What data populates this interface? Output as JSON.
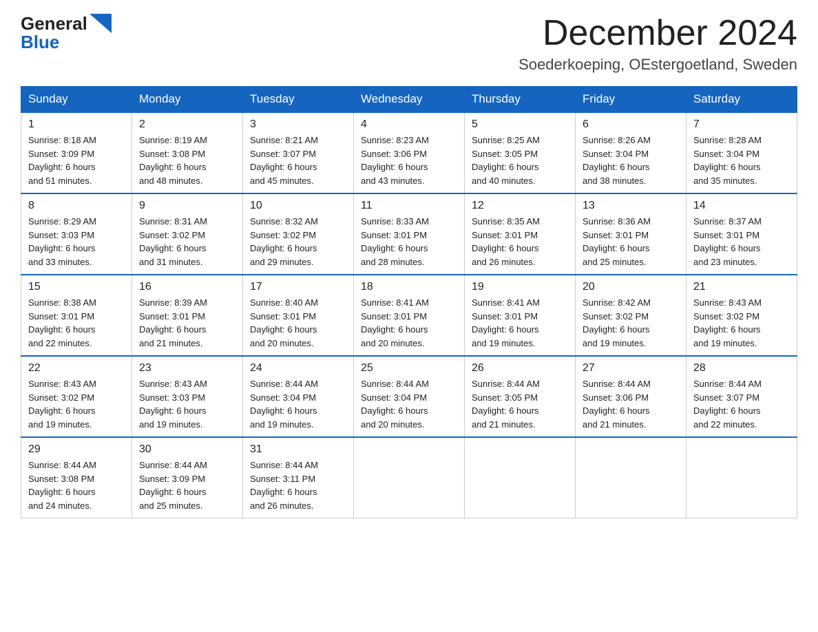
{
  "header": {
    "logo_general": "General",
    "logo_blue": "Blue",
    "month_title": "December 2024",
    "location": "Soederkoeping, OEstergoetland, Sweden"
  },
  "weekdays": [
    "Sunday",
    "Monday",
    "Tuesday",
    "Wednesday",
    "Thursday",
    "Friday",
    "Saturday"
  ],
  "weeks": [
    [
      {
        "day": "1",
        "sunrise": "Sunrise: 8:18 AM",
        "sunset": "Sunset: 3:09 PM",
        "daylight": "Daylight: 6 hours",
        "minutes": "and 51 minutes."
      },
      {
        "day": "2",
        "sunrise": "Sunrise: 8:19 AM",
        "sunset": "Sunset: 3:08 PM",
        "daylight": "Daylight: 6 hours",
        "minutes": "and 48 minutes."
      },
      {
        "day": "3",
        "sunrise": "Sunrise: 8:21 AM",
        "sunset": "Sunset: 3:07 PM",
        "daylight": "Daylight: 6 hours",
        "minutes": "and 45 minutes."
      },
      {
        "day": "4",
        "sunrise": "Sunrise: 8:23 AM",
        "sunset": "Sunset: 3:06 PM",
        "daylight": "Daylight: 6 hours",
        "minutes": "and 43 minutes."
      },
      {
        "day": "5",
        "sunrise": "Sunrise: 8:25 AM",
        "sunset": "Sunset: 3:05 PM",
        "daylight": "Daylight: 6 hours",
        "minutes": "and 40 minutes."
      },
      {
        "day": "6",
        "sunrise": "Sunrise: 8:26 AM",
        "sunset": "Sunset: 3:04 PM",
        "daylight": "Daylight: 6 hours",
        "minutes": "and 38 minutes."
      },
      {
        "day": "7",
        "sunrise": "Sunrise: 8:28 AM",
        "sunset": "Sunset: 3:04 PM",
        "daylight": "Daylight: 6 hours",
        "minutes": "and 35 minutes."
      }
    ],
    [
      {
        "day": "8",
        "sunrise": "Sunrise: 8:29 AM",
        "sunset": "Sunset: 3:03 PM",
        "daylight": "Daylight: 6 hours",
        "minutes": "and 33 minutes."
      },
      {
        "day": "9",
        "sunrise": "Sunrise: 8:31 AM",
        "sunset": "Sunset: 3:02 PM",
        "daylight": "Daylight: 6 hours",
        "minutes": "and 31 minutes."
      },
      {
        "day": "10",
        "sunrise": "Sunrise: 8:32 AM",
        "sunset": "Sunset: 3:02 PM",
        "daylight": "Daylight: 6 hours",
        "minutes": "and 29 minutes."
      },
      {
        "day": "11",
        "sunrise": "Sunrise: 8:33 AM",
        "sunset": "Sunset: 3:01 PM",
        "daylight": "Daylight: 6 hours",
        "minutes": "and 28 minutes."
      },
      {
        "day": "12",
        "sunrise": "Sunrise: 8:35 AM",
        "sunset": "Sunset: 3:01 PM",
        "daylight": "Daylight: 6 hours",
        "minutes": "and 26 minutes."
      },
      {
        "day": "13",
        "sunrise": "Sunrise: 8:36 AM",
        "sunset": "Sunset: 3:01 PM",
        "daylight": "Daylight: 6 hours",
        "minutes": "and 25 minutes."
      },
      {
        "day": "14",
        "sunrise": "Sunrise: 8:37 AM",
        "sunset": "Sunset: 3:01 PM",
        "daylight": "Daylight: 6 hours",
        "minutes": "and 23 minutes."
      }
    ],
    [
      {
        "day": "15",
        "sunrise": "Sunrise: 8:38 AM",
        "sunset": "Sunset: 3:01 PM",
        "daylight": "Daylight: 6 hours",
        "minutes": "and 22 minutes."
      },
      {
        "day": "16",
        "sunrise": "Sunrise: 8:39 AM",
        "sunset": "Sunset: 3:01 PM",
        "daylight": "Daylight: 6 hours",
        "minutes": "and 21 minutes."
      },
      {
        "day": "17",
        "sunrise": "Sunrise: 8:40 AM",
        "sunset": "Sunset: 3:01 PM",
        "daylight": "Daylight: 6 hours",
        "minutes": "and 20 minutes."
      },
      {
        "day": "18",
        "sunrise": "Sunrise: 8:41 AM",
        "sunset": "Sunset: 3:01 PM",
        "daylight": "Daylight: 6 hours",
        "minutes": "and 20 minutes."
      },
      {
        "day": "19",
        "sunrise": "Sunrise: 8:41 AM",
        "sunset": "Sunset: 3:01 PM",
        "daylight": "Daylight: 6 hours",
        "minutes": "and 19 minutes."
      },
      {
        "day": "20",
        "sunrise": "Sunrise: 8:42 AM",
        "sunset": "Sunset: 3:02 PM",
        "daylight": "Daylight: 6 hours",
        "minutes": "and 19 minutes."
      },
      {
        "day": "21",
        "sunrise": "Sunrise: 8:43 AM",
        "sunset": "Sunset: 3:02 PM",
        "daylight": "Daylight: 6 hours",
        "minutes": "and 19 minutes."
      }
    ],
    [
      {
        "day": "22",
        "sunrise": "Sunrise: 8:43 AM",
        "sunset": "Sunset: 3:02 PM",
        "daylight": "Daylight: 6 hours",
        "minutes": "and 19 minutes."
      },
      {
        "day": "23",
        "sunrise": "Sunrise: 8:43 AM",
        "sunset": "Sunset: 3:03 PM",
        "daylight": "Daylight: 6 hours",
        "minutes": "and 19 minutes."
      },
      {
        "day": "24",
        "sunrise": "Sunrise: 8:44 AM",
        "sunset": "Sunset: 3:04 PM",
        "daylight": "Daylight: 6 hours",
        "minutes": "and 19 minutes."
      },
      {
        "day": "25",
        "sunrise": "Sunrise: 8:44 AM",
        "sunset": "Sunset: 3:04 PM",
        "daylight": "Daylight: 6 hours",
        "minutes": "and 20 minutes."
      },
      {
        "day": "26",
        "sunrise": "Sunrise: 8:44 AM",
        "sunset": "Sunset: 3:05 PM",
        "daylight": "Daylight: 6 hours",
        "minutes": "and 21 minutes."
      },
      {
        "day": "27",
        "sunrise": "Sunrise: 8:44 AM",
        "sunset": "Sunset: 3:06 PM",
        "daylight": "Daylight: 6 hours",
        "minutes": "and 21 minutes."
      },
      {
        "day": "28",
        "sunrise": "Sunrise: 8:44 AM",
        "sunset": "Sunset: 3:07 PM",
        "daylight": "Daylight: 6 hours",
        "minutes": "and 22 minutes."
      }
    ],
    [
      {
        "day": "29",
        "sunrise": "Sunrise: 8:44 AM",
        "sunset": "Sunset: 3:08 PM",
        "daylight": "Daylight: 6 hours",
        "minutes": "and 24 minutes."
      },
      {
        "day": "30",
        "sunrise": "Sunrise: 8:44 AM",
        "sunset": "Sunset: 3:09 PM",
        "daylight": "Daylight: 6 hours",
        "minutes": "and 25 minutes."
      },
      {
        "day": "31",
        "sunrise": "Sunrise: 8:44 AM",
        "sunset": "Sunset: 3:11 PM",
        "daylight": "Daylight: 6 hours",
        "minutes": "and 26 minutes."
      },
      null,
      null,
      null,
      null
    ]
  ]
}
